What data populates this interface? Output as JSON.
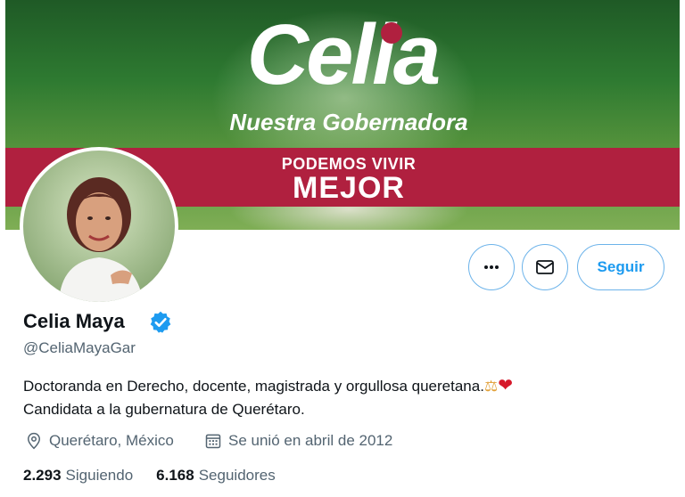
{
  "banner": {
    "name": "Celia",
    "subtitle": "Nuestra Gobernadora",
    "slogan_top": "PODEMOS VIVIR",
    "slogan_bottom": "MEJOR"
  },
  "profile": {
    "display_name": "Celia Maya",
    "handle": "@CeliaMayaGar",
    "bio_line1": "Doctoranda en Derecho, docente, magistrada y orgullosa queretana.",
    "bio_line2": "Candidata a la gubernatura de Querétaro.",
    "bio_emoji1": "⚖",
    "bio_emoji2": "❤",
    "location": "Querétaro, México",
    "joined": "Se unió en abril de 2012"
  },
  "actions": {
    "more_icon": "ellipsis-icon",
    "message_icon": "mail-icon",
    "follow_label": "Seguir"
  },
  "stats": {
    "following_count": "2.293",
    "following_label": "Siguiendo",
    "followers_count": "6.168",
    "followers_label": "Seguidores"
  },
  "colors": {
    "accent": "#1d9bf0",
    "banner_red": "#b0203f",
    "text_secondary": "#536471"
  }
}
